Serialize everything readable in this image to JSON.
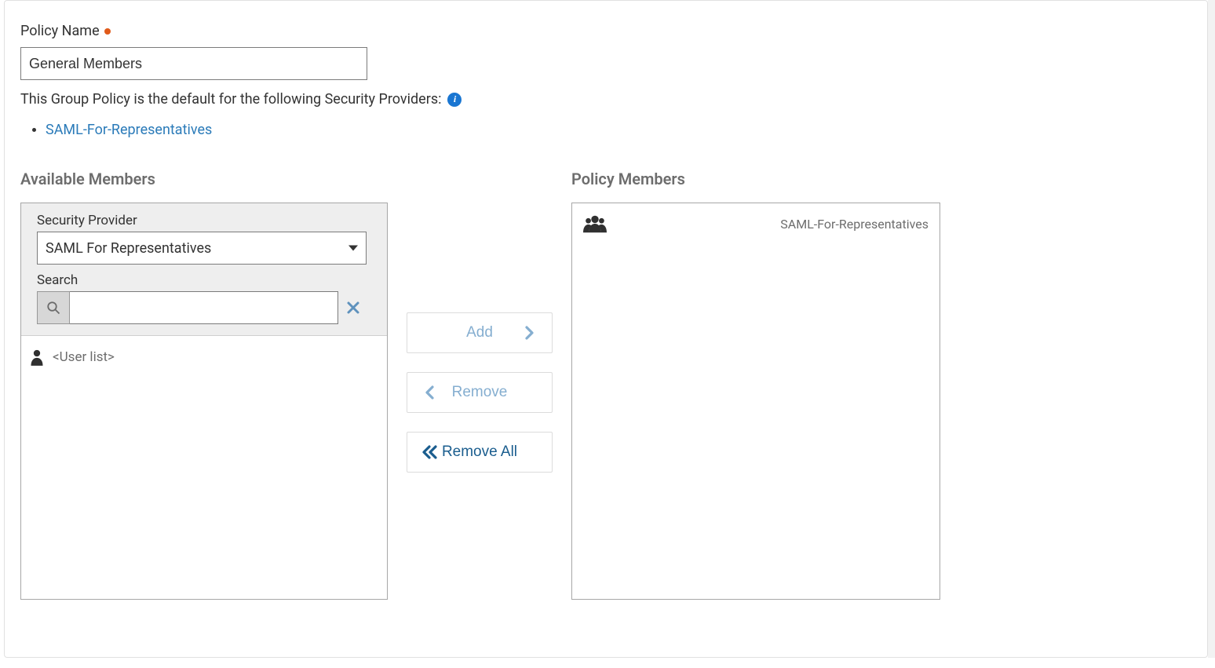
{
  "policyName": {
    "label": "Policy Name",
    "value": "General Members"
  },
  "defaultFor": {
    "text": "This Group Policy is the default for the following Security Providers:",
    "providers": [
      {
        "label": "SAML-For-Representatives"
      }
    ]
  },
  "available": {
    "heading": "Available Members",
    "securityProviderLabel": "Security Provider",
    "securityProviderValue": "SAML For Representatives",
    "searchLabel": "Search",
    "userListPlaceholder": "<User list>"
  },
  "buttons": {
    "add": "Add",
    "remove": "Remove",
    "removeAll": "Remove All"
  },
  "policy": {
    "heading": "Policy Members",
    "members": [
      {
        "label": "SAML-For-Representatives"
      }
    ]
  }
}
